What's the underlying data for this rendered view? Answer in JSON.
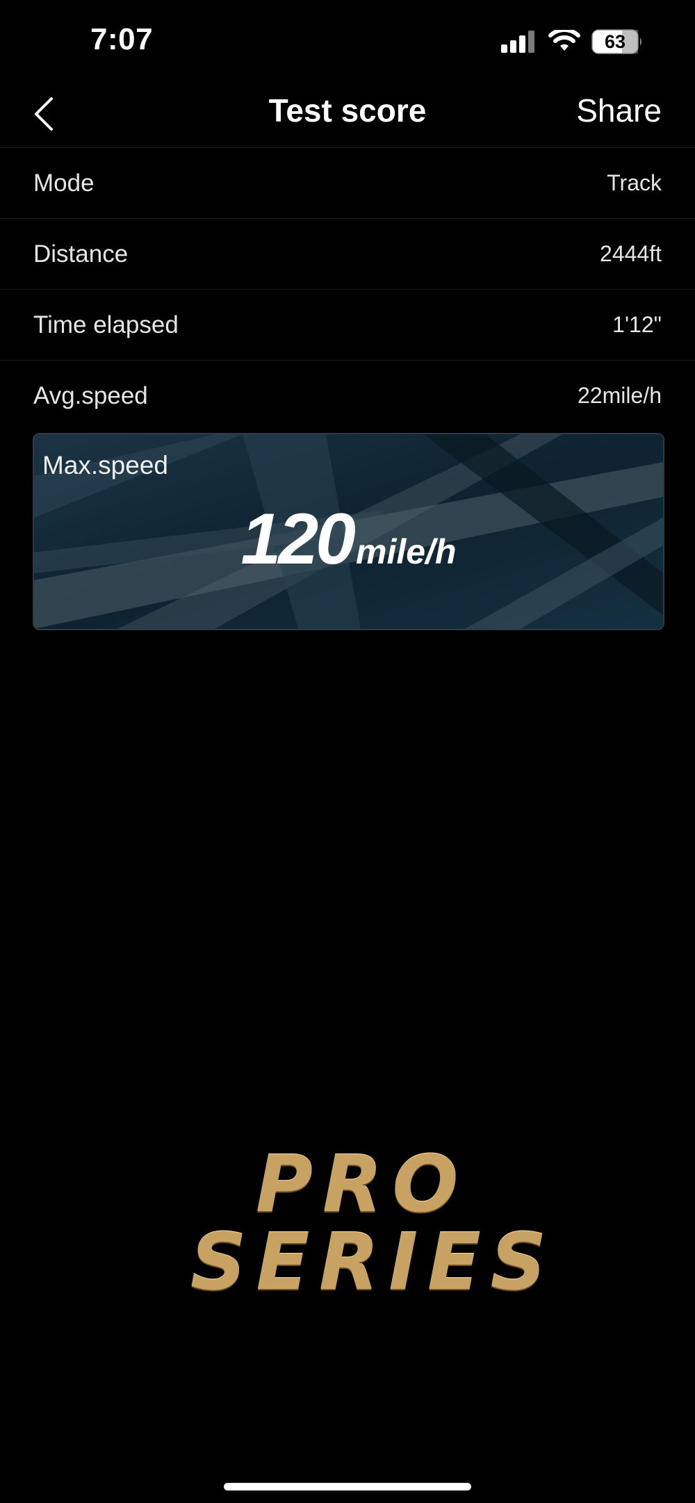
{
  "status_bar": {
    "time": "7:07",
    "battery": "63"
  },
  "nav": {
    "title": "Test score",
    "share_label": "Share"
  },
  "rows": [
    {
      "label": "Mode",
      "value": "Track"
    },
    {
      "label": "Distance",
      "value": "2444ft"
    },
    {
      "label": "Time elapsed",
      "value": "1'12\""
    },
    {
      "label": "Avg.speed",
      "value": "22mile/h"
    }
  ],
  "max_speed": {
    "label": "Max.speed",
    "value": "120",
    "unit": "mile/h"
  },
  "logo": {
    "line1": "PRO",
    "line2": "SERIES"
  },
  "colors": {
    "background": "#000000",
    "text": "#ffffff",
    "gold": "#c8a262",
    "card": "#0d1c27"
  }
}
